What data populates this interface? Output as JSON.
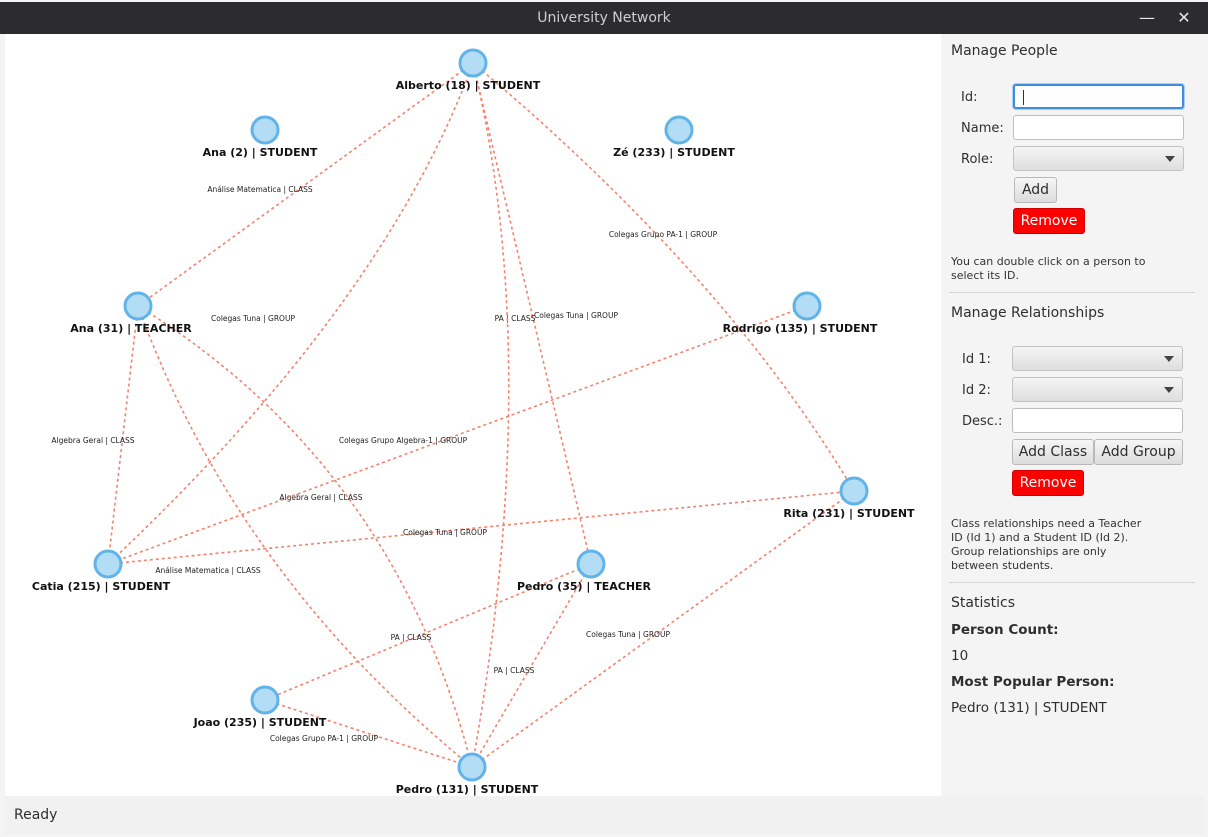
{
  "window": {
    "title": "University Network",
    "minimize_symbol": "—",
    "close_symbol": "✕"
  },
  "graph": {
    "node_fill": "#b3dcf5",
    "node_stroke": "#62b4e8",
    "edge_color": "#f4826c",
    "nodes": [
      {
        "id": "alberto18",
        "label": "Alberto (18) | STUDENT"
      },
      {
        "id": "ana2",
        "label": "Ana (2) | STUDENT"
      },
      {
        "id": "ze233",
        "label": "Zé (233) | STUDENT"
      },
      {
        "id": "ana31",
        "label": "Ana (31) | TEACHER"
      },
      {
        "id": "rodrigo135",
        "label": "Rodrigo (135) | STUDENT"
      },
      {
        "id": "rita231",
        "label": "Rita (231) | STUDENT"
      },
      {
        "id": "catia215",
        "label": "Catia (215) | STUDENT"
      },
      {
        "id": "pedro35",
        "label": "Pedro (35) | TEACHER"
      },
      {
        "id": "joao235",
        "label": "Joao (235) | STUDENT"
      },
      {
        "id": "pedro131",
        "label": "Pedro (131) | STUDENT"
      }
    ],
    "edges": [
      {
        "from": "alberto18",
        "to": "ana31",
        "label": "Análise Matematica | CLASS"
      },
      {
        "from": "alberto18",
        "to": "catia215",
        "label": "Colegas Tuna | GROUP"
      },
      {
        "from": "alberto18",
        "to": "pedro35",
        "label": "PA | CLASS"
      },
      {
        "from": "alberto18",
        "to": "rita231",
        "label": "Colegas Grupo PA-1 | GROUP"
      },
      {
        "from": "alberto18",
        "to": "pedro131",
        "label": "Colegas Tuna | GROUP"
      },
      {
        "from": "ana31",
        "to": "catia215",
        "label": "Algebra Geral | CLASS"
      },
      {
        "from": "ana31",
        "to": "pedro131",
        "label": "Algebra Geral | CLASS"
      },
      {
        "from": "ana31",
        "to": "pedro131",
        "label": "Análise Matematica | CLASS"
      },
      {
        "from": "rodrigo135",
        "to": "catia215",
        "label": "Colegas Grupo Algebra-1 | GROUP"
      },
      {
        "from": "catia215",
        "to": "rita231",
        "label": "Colegas Tuna | GROUP"
      },
      {
        "from": "pedro35",
        "to": "joao235",
        "label": "PA | CLASS"
      },
      {
        "from": "pedro35",
        "to": "pedro131",
        "label": "PA | CLASS"
      },
      {
        "from": "rita231",
        "to": "pedro131",
        "label": "Colegas Tuna | GROUP"
      },
      {
        "from": "joao235",
        "to": "pedro131",
        "label": "Colegas Grupo PA-1 | GROUP"
      }
    ]
  },
  "manage_people": {
    "title": "Manage People",
    "id_label": "Id:",
    "id_value": "",
    "name_label": "Name:",
    "name_value": "",
    "role_label": "Role:",
    "role_value": "",
    "add_label": "Add",
    "remove_label": "Remove",
    "note": "You can double click on a person to select its ID."
  },
  "manage_relationships": {
    "title": "Manage Relationships",
    "id1_label": "Id 1:",
    "id1_value": "",
    "id2_label": "Id 2:",
    "id2_value": "",
    "desc_label": "Desc.:",
    "desc_value": "",
    "add_class_label": "Add Class",
    "add_group_label": "Add Group",
    "remove_label": "Remove",
    "note": "Class relationships need a Teacher ID (Id 1) and a Student ID (Id 2). Group relationships are only between students."
  },
  "statistics": {
    "title": "Statistics",
    "person_count_label": "Person Count:",
    "person_count_value": "10",
    "most_popular_label": "Most Popular Person:",
    "most_popular_value": "Pedro (131) | STUDENT"
  },
  "status": {
    "text": "Ready"
  }
}
